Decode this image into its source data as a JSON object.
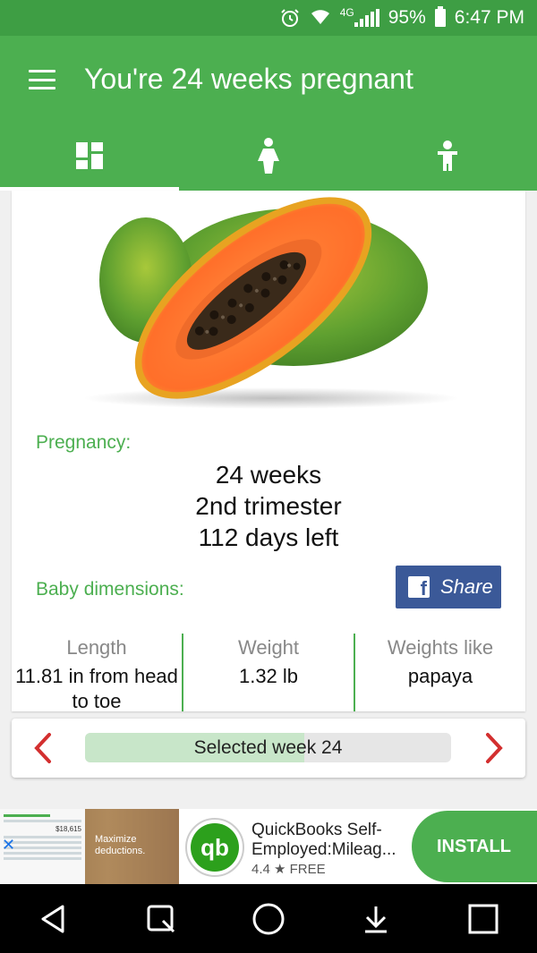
{
  "status_bar": {
    "network": "4G",
    "battery": "95%",
    "time": "6:47 PM"
  },
  "app_bar": {
    "title": "You're 24 weeks pregnant",
    "tabs": [
      {
        "icon": "dashboard-icon",
        "active": true
      },
      {
        "icon": "mother-icon",
        "active": false
      },
      {
        "icon": "baby-icon",
        "active": false
      }
    ]
  },
  "card": {
    "image": "papaya-image",
    "pregnancy_label": "Pregnancy:",
    "pregnancy_lines": [
      "24 weeks",
      "2nd trimester",
      "112 days left"
    ],
    "baby_label": "Baby dimensions:",
    "share_label": "Share",
    "dimensions": [
      {
        "heading": "Length",
        "value": "11.81 in from head to toe"
      },
      {
        "heading": "Weight",
        "value": "1.32 lb"
      },
      {
        "heading": "Weights like",
        "value": "papaya"
      }
    ]
  },
  "week_selector": {
    "label": "Selected week 24",
    "progress_fraction": 0.6
  },
  "ad": {
    "tagline": "Maximize deductions.",
    "screen_amount": "$18,615",
    "logo_text": "qb",
    "title": "QuickBooks Self-Employed:Mileag...",
    "rating": "4.4 ★ FREE",
    "install_label": "INSTALL"
  },
  "colors": {
    "primary": "#4caf50",
    "primary_dark": "#3e9e44",
    "facebook": "#3b5998",
    "accent_red": "#d32f2f"
  }
}
